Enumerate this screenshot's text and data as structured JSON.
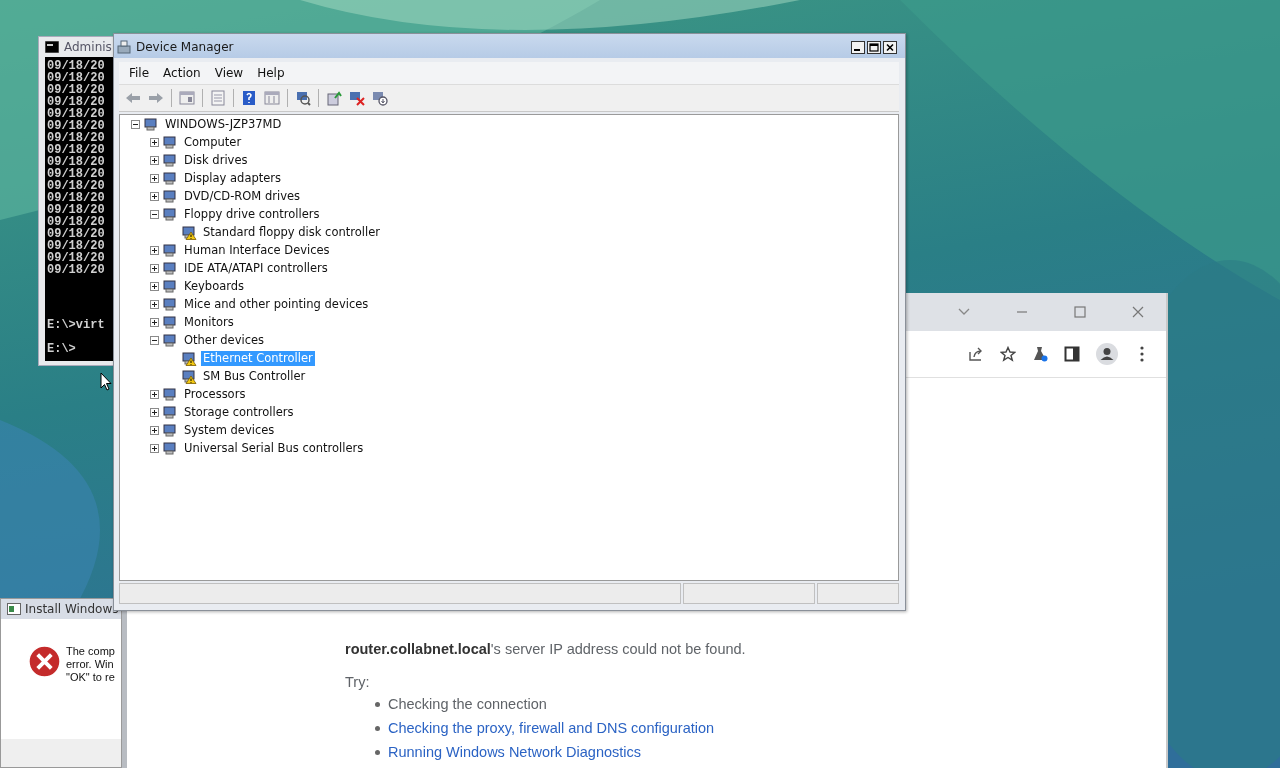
{
  "console_window": {
    "title": "Adminis",
    "lines": [
      "09/18/20",
      "09/18/20",
      "09/18/20",
      "09/18/20",
      "09/18/20",
      "09/18/20",
      "09/18/20",
      "09/18/20",
      "09/18/20",
      "09/18/20",
      "09/18/20",
      "09/18/20",
      "09/18/20",
      "09/18/20",
      "09/18/20",
      "09/18/20",
      "09/18/20",
      "09/18/20"
    ],
    "prompt_lines": [
      "E:\\>virt",
      "E:\\>"
    ]
  },
  "device_manager": {
    "title": "Device Manager",
    "menu": [
      "File",
      "Action",
      "View",
      "Help"
    ],
    "tree": {
      "label": "WINDOWS-JZP37MD",
      "expanded": true,
      "selected": false,
      "warning": false,
      "children": [
        {
          "label": "Computer",
          "expanded": false,
          "selected": false,
          "warning": false
        },
        {
          "label": "Disk drives",
          "expanded": false,
          "selected": false,
          "warning": false
        },
        {
          "label": "Display adapters",
          "expanded": false,
          "selected": false,
          "warning": false
        },
        {
          "label": "DVD/CD-ROM drives",
          "expanded": false,
          "selected": false,
          "warning": false
        },
        {
          "label": "Floppy drive controllers",
          "expanded": true,
          "selected": false,
          "warning": false,
          "children": [
            {
              "label": "Standard floppy disk controller",
              "selected": false,
              "warning": true
            }
          ]
        },
        {
          "label": "Human Interface Devices",
          "expanded": false,
          "selected": false,
          "warning": false
        },
        {
          "label": "IDE ATA/ATAPI controllers",
          "expanded": false,
          "selected": false,
          "warning": false
        },
        {
          "label": "Keyboards",
          "expanded": false,
          "selected": false,
          "warning": false
        },
        {
          "label": "Mice and other pointing devices",
          "expanded": false,
          "selected": false,
          "warning": false
        },
        {
          "label": "Monitors",
          "expanded": false,
          "selected": false,
          "warning": false
        },
        {
          "label": "Other devices",
          "expanded": true,
          "selected": false,
          "warning": false,
          "children": [
            {
              "label": "Ethernet Controller",
              "selected": true,
              "warning": true
            },
            {
              "label": "SM Bus Controller",
              "selected": false,
              "warning": true
            }
          ]
        },
        {
          "label": "Processors",
          "expanded": false,
          "selected": false,
          "warning": false
        },
        {
          "label": "Storage controllers",
          "expanded": false,
          "selected": false,
          "warning": false
        },
        {
          "label": "System devices",
          "expanded": false,
          "selected": false,
          "warning": false
        },
        {
          "label": "Universal Serial Bus controllers",
          "expanded": false,
          "selected": false,
          "warning": false
        }
      ]
    }
  },
  "install_dialog": {
    "title": "Install Windows",
    "message_lines": [
      "The comp",
      "error. Win",
      "\"OK\" to re"
    ]
  },
  "browser": {
    "message": "**router.collabnet.local**'s server IP address could not be found.",
    "try_label": "Try:",
    "suggestions": [
      {
        "text": "Checking the connection",
        "kind": "text"
      },
      {
        "text": "Checking the proxy, firewall and DNS configuration",
        "kind": "link"
      },
      {
        "text": "Running Windows Network Diagnostics",
        "kind": "link"
      }
    ]
  }
}
